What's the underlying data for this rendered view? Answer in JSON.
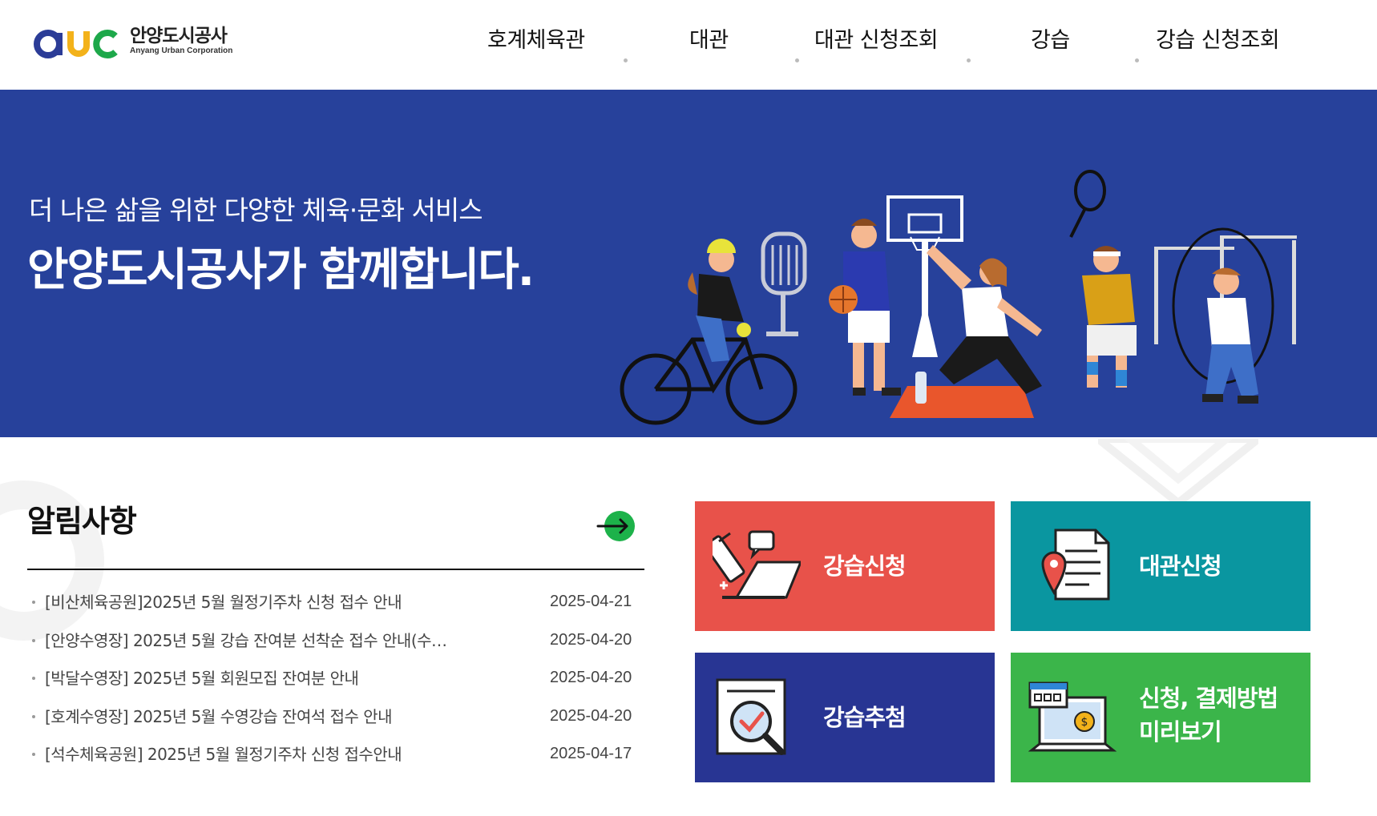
{
  "header": {
    "logo_ko": "안양도시공사",
    "logo_en": "Anyang Urban Corporation",
    "nav": [
      "호계체육관",
      "대관",
      "대관 신청조회",
      "강습",
      "강습 신청조회"
    ]
  },
  "banner": {
    "subtitle": "더 나은 삶을 위한 다양한 체육·문화 서비스",
    "title": "안양도시공사가 함께합니다."
  },
  "notice": {
    "title": "알림사항",
    "items": [
      {
        "text": "[비산체육공원]2025년 5월 월정기주차 신청 접수 안내",
        "date": "2025-04-21"
      },
      {
        "text": "[안양수영장] 2025년 5월 강습 잔여분 선착순 접수 안내(수…",
        "date": "2025-04-20"
      },
      {
        "text": "[박달수영장] 2025년 5월 회원모집 잔여분 안내",
        "date": "2025-04-20"
      },
      {
        "text": "[호계수영장] 2025년 5월 수영강습 잔여석 접수 안내",
        "date": "2025-04-20"
      },
      {
        "text": "[석수체육공원] 2025년 5월 월정기주차 신청 접수안내",
        "date": "2025-04-17"
      }
    ]
  },
  "tiles": {
    "lesson_apply": {
      "label": "강습신청",
      "color": "#e8524a",
      "icon": "pencil-laptop-icon"
    },
    "rental_apply": {
      "label": "대관신청",
      "color": "#0a96a0",
      "icon": "document-pin-icon"
    },
    "lesson_draw": {
      "label": "강습추첨",
      "color": "#283593",
      "icon": "magnifier-check-icon"
    },
    "payment_preview": {
      "label_line1": "신청, 결제방법",
      "label_line2": "미리보기",
      "color": "#3bb54a",
      "icon": "payment-screen-icon"
    }
  },
  "colors": {
    "banner_bg": "#27419b",
    "accent_green": "#1db24a"
  }
}
